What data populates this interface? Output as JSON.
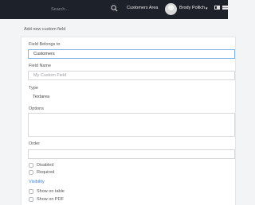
{
  "topbar": {
    "search_placeholder": "Search...",
    "area_link": "Customers Area",
    "user_name": "Brody Pollich",
    "user_caret": "▾",
    "icons": [
      "search-icon",
      "avatar",
      "layout-icon",
      "flag-icon"
    ]
  },
  "page": {
    "title": "Add new custom field"
  },
  "form": {
    "belongs_to": {
      "label": "Field Belongs to",
      "value": "Customers"
    },
    "name": {
      "label": "Field Name",
      "placeholder": "My Custom Field"
    },
    "type": {
      "label": "Type",
      "value": "Textarea"
    },
    "options": {
      "label": "Options"
    },
    "order": {
      "label": "Order"
    },
    "disabled": {
      "label": "Disabled",
      "checked": false
    },
    "required": {
      "label": "Required",
      "checked": false
    },
    "visibility": {
      "title": "Visibility",
      "show_on_table": {
        "label": "Show on table",
        "checked": false
      },
      "show_on_pdf": {
        "label": "Show on PDF",
        "checked": false
      }
    }
  },
  "colors": {
    "topbar": "#1d2129",
    "accent": "#3d7ec8",
    "active_border": "#7fb6e8"
  }
}
